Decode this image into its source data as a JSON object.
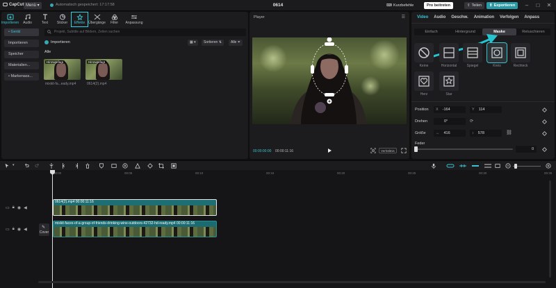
{
  "titlebar": {
    "app_name": "CapCut",
    "menu_label": "Menü",
    "autosave_text": "Automatisch gespeichert: 17:17:58",
    "project_title": "0614",
    "shortcuts_label": "Kurzbefehle",
    "pro_label": "Pro beitreten",
    "share_label": "Teilen",
    "export_label": "Exportieren"
  },
  "toolbar": {
    "items": [
      {
        "label": "Importieren",
        "icon": "import-icon"
      },
      {
        "label": "Audio",
        "icon": "audio-icon"
      },
      {
        "label": "Text",
        "icon": "text-icon"
      },
      {
        "label": "Sticker",
        "icon": "sticker-icon"
      },
      {
        "label": "Effekte",
        "icon": "effects-icon"
      },
      {
        "label": "Übergänge",
        "icon": "transitions-icon"
      },
      {
        "label": "Filter",
        "icon": "filter-icon"
      },
      {
        "label": "Anpassung",
        "icon": "adjust-icon"
      }
    ]
  },
  "library": {
    "sidebar": [
      "• Gerät",
      "Importieren",
      "Speicher",
      "Materialien...",
      "• Markenass..."
    ],
    "search_placeholder": "Projekt, Subtitle auf Bildern, Zeilen suchen",
    "import_label": "Importieren",
    "sort_label": "Sortieren",
    "filter_label": "Alle",
    "section_label": "Alle",
    "clips": [
      {
        "badge": "Hinzugefügt",
        "name": "mixkit-fa...eady.mp4"
      },
      {
        "badge": "Hinzugefügt",
        "name": "0614(2).mp4"
      }
    ]
  },
  "player": {
    "title": "Player",
    "time_current": "00:00:00:00",
    "time_total": "00:00:11:16",
    "ratio_label": "Verhältnis"
  },
  "inspector": {
    "tabs": [
      "Video",
      "Audio",
      "Geschw.",
      "Animation",
      "Verfolgen",
      "Anpass"
    ],
    "subtabs": [
      "Einfach",
      "Hintergrund",
      "Maske",
      "Retuschieren"
    ],
    "masks": [
      "Keine",
      "Horizontal",
      "Spiegel",
      "Kreis",
      "Rechteck",
      "Herz",
      "Star"
    ],
    "position_label": "Position",
    "position_x": "-164",
    "position_y": "114",
    "rotate_label": "Drehen",
    "rotate_value": "0°",
    "size_label": "Größe",
    "size_w": "416",
    "size_h": "578",
    "feather_label": "Feder",
    "feather_value": "0",
    "x_tag": "X",
    "y_tag": "Y"
  },
  "timeline": {
    "ticks": [
      "00:00",
      "00:05",
      "00:10",
      "00:15",
      "00:20",
      "00:25",
      "00:30",
      "00:35"
    ],
    "clip_top_name": "0614(2).mp4",
    "clip_top_duration": "00:00:11:16",
    "clip_main_name": "mixkit-faces-of-a-group-of-friends-drinking-wine-outdoors-42732-hd-ready.mp4",
    "clip_main_duration": "00:00:11:16",
    "cover_label": "Cover"
  },
  "colors": {
    "accent": "#3cc4d2",
    "export": "#2a9aa7"
  }
}
